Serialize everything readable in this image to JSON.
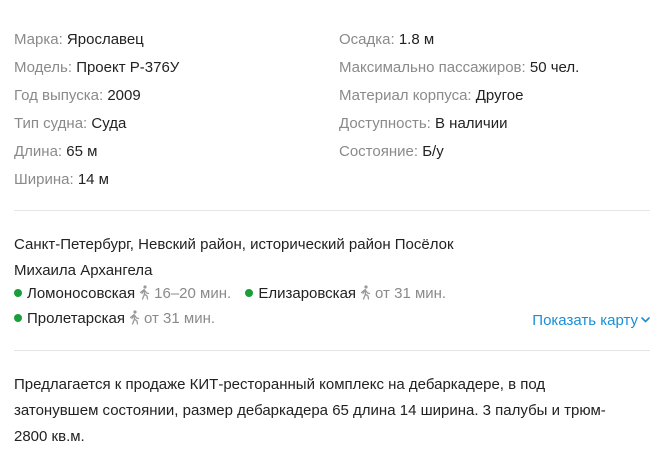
{
  "params": {
    "left": [
      {
        "label": "Марка:",
        "value": "Ярославец"
      },
      {
        "label": "Модель:",
        "value": "Проект Р-376У"
      },
      {
        "label": "Год выпуска:",
        "value": "2009"
      },
      {
        "label": "Тип судна:",
        "value": "Суда"
      },
      {
        "label": "Длина:",
        "value": "65 м"
      },
      {
        "label": "Ширина:",
        "value": "14 м"
      }
    ],
    "right": [
      {
        "label": "Осадка:",
        "value": "1.8 м"
      },
      {
        "label": "Максимально пассажиров:",
        "value": "50 чел."
      },
      {
        "label": "Материал корпуса:",
        "value": "Другое"
      },
      {
        "label": "Доступность:",
        "value": "В наличии"
      },
      {
        "label": "Состояние:",
        "value": "Б/у"
      }
    ]
  },
  "address": {
    "line1": "Санкт-Петербург, Невский район, исторический район Посёлок",
    "line2": "Михаила Архангела"
  },
  "metro": [
    {
      "name": "Ломоносовская",
      "time": "16–20 мин.",
      "color": "#1a9e3c",
      "icon": "walk-icon"
    },
    {
      "name": "Елизаровская",
      "time": "от 31 мин.",
      "color": "#1a9e3c",
      "icon": "walk-icon"
    },
    {
      "name": "Пролетарская",
      "time": "от 31 мин.",
      "color": "#1a9e3c",
      "icon": "walk-icon"
    }
  ],
  "show_map": {
    "label": "Показать карту",
    "color": "#1a8fd6",
    "icon": "chevron-down-icon"
  },
  "description": {
    "line1": "Предлагается к продаже КИТ-ресторанный комплекс на дебаркадере, в под",
    "line2": "затонувшем состоянии, размер дебаркадера 65 длина 14 ширина. 3 палубы и трюм-",
    "line3": "2800 кв.м."
  }
}
